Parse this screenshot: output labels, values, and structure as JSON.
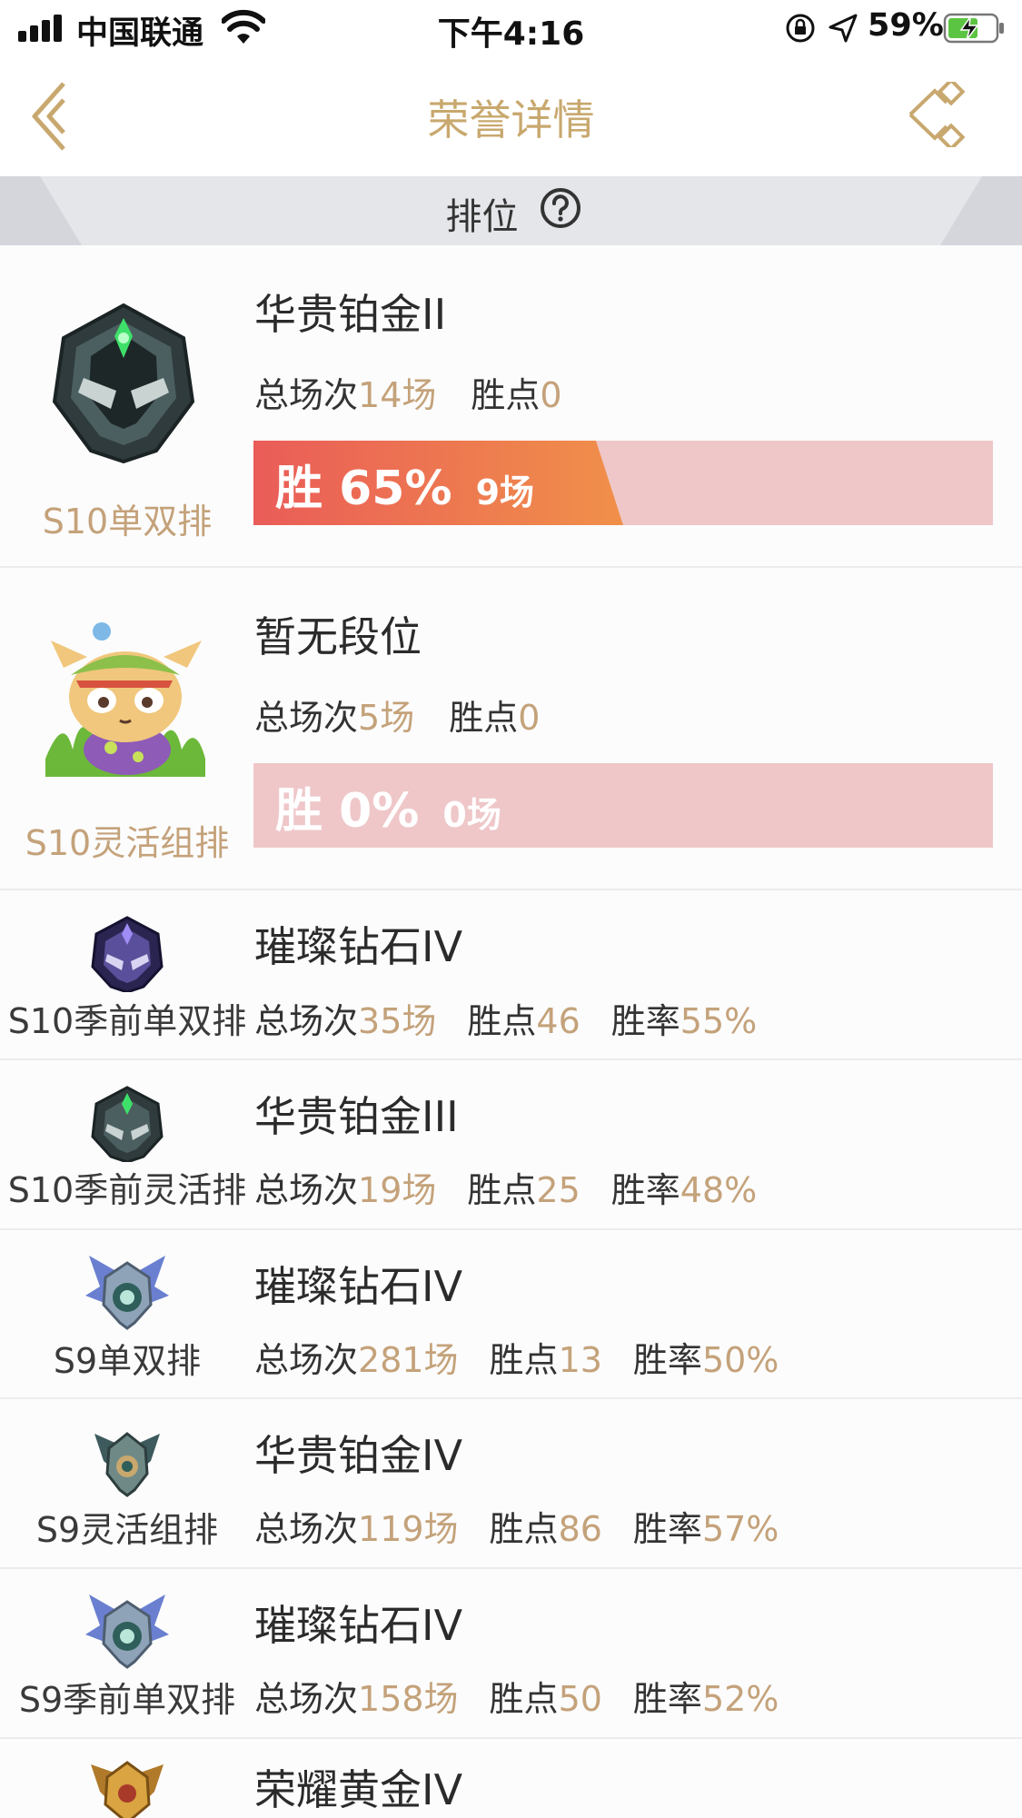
{
  "status_bar": {
    "carrier": "中国联通",
    "time": "下午4:16",
    "battery_percent": "59%",
    "icons": [
      "signal-icon",
      "wifi-icon",
      "orientation-lock-icon",
      "location-icon",
      "battery-charging-icon"
    ]
  },
  "nav": {
    "title": "荣誉详情",
    "back_icon": "back-chevron-icon",
    "share_icon": "share-icon"
  },
  "section": {
    "title": "排位",
    "help_icon": "help-circle-icon"
  },
  "labels": {
    "total_games": "总场次",
    "lp": "胜点",
    "win_rate": "胜率",
    "win": "胜"
  },
  "featured": [
    {
      "queue": "S10单双排",
      "rank": "华贵铂金II",
      "total": "14场",
      "lp": "0",
      "win_pct_text": "65%",
      "wins_text": "9场",
      "win_fraction": 0.5
    },
    {
      "queue": "S10灵活组排",
      "rank": "暂无段位",
      "total": "5场",
      "lp": "0",
      "win_pct_text": "0%",
      "wins_text": "0场",
      "win_fraction": 0
    }
  ],
  "history": [
    {
      "queue": "S10季前单双排",
      "rank": "璀璨钻石IV",
      "total": "35场",
      "lp": "46",
      "win_rate": "55%"
    },
    {
      "queue": "S10季前灵活排",
      "rank": "华贵铂金III",
      "total": "19场",
      "lp": "25",
      "win_rate": "48%"
    },
    {
      "queue": "S9单双排",
      "rank": "璀璨钻石IV",
      "total": "281场",
      "lp": "13",
      "win_rate": "50%"
    },
    {
      "queue": "S9灵活组排",
      "rank": "华贵铂金IV",
      "total": "119场",
      "lp": "86",
      "win_rate": "57%"
    },
    {
      "queue": "S9季前单双排",
      "rank": "璀璨钻石IV",
      "total": "158场",
      "lp": "50",
      "win_rate": "52%"
    },
    {
      "queue": "",
      "rank": "荣耀黄金IV",
      "total": "",
      "lp": "",
      "win_rate": ""
    }
  ],
  "colors": {
    "accent_gold": "#c8a86e",
    "value_gold": "#c4a27a",
    "bar_red": "#ea5c58",
    "bar_orange": "#f0904a",
    "bar_track": "#efc7c9"
  }
}
